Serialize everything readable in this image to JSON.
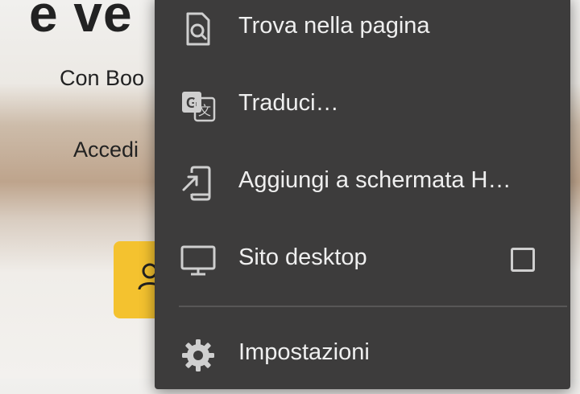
{
  "background": {
    "title_fragment": "e ve",
    "subtitle_fragment": "Con Boo",
    "accedi_fragment": "Accedi",
    "button_icon": "person-icon"
  },
  "menu": {
    "items": [
      {
        "label": "Trova nella pagina",
        "icon": "find-in-page-icon"
      },
      {
        "label": "Traduci…",
        "icon": "translate-icon"
      },
      {
        "label": "Aggiungi a schermata H…",
        "icon": "add-to-home-screen-icon"
      },
      {
        "label": "Sito desktop",
        "icon": "desktop-icon",
        "checked": false
      },
      {
        "label": "Impostazioni",
        "icon": "settings-gear-icon"
      }
    ]
  },
  "colors": {
    "menu_bg": "#3d3c3c",
    "menu_text": "#efefef",
    "accent_yellow": "#f4c22f"
  }
}
